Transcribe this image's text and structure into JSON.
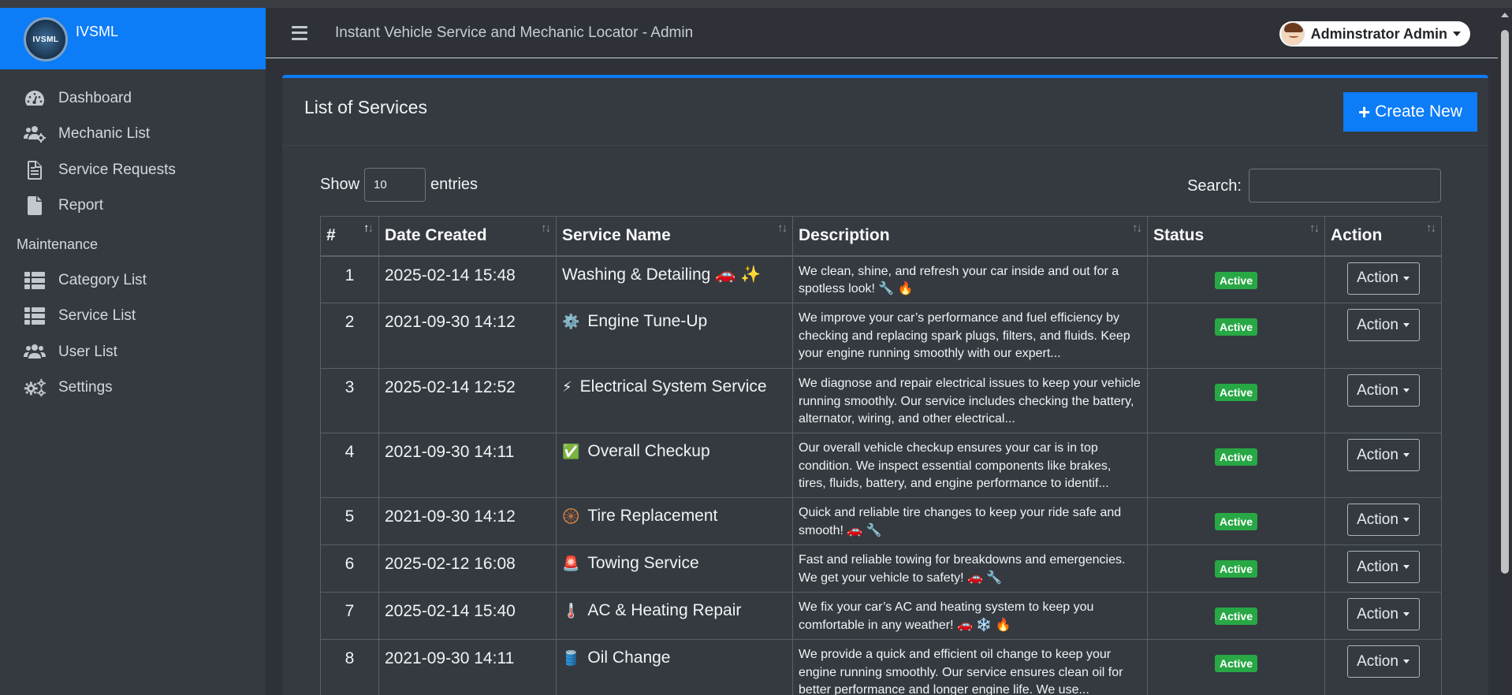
{
  "app": {
    "brand_short": "IVSML",
    "logo_text": "IVSML",
    "title": "Instant Vehicle Service and Mechanic Locator - Admin"
  },
  "user": {
    "name": "Adminstrator Admin"
  },
  "sidebar": {
    "items": [
      {
        "label": "Dashboard",
        "icon": "tachometer-icon"
      },
      {
        "label": "Mechanic List",
        "icon": "users-cog-icon"
      },
      {
        "label": "Service Requests",
        "icon": "file-alt-icon"
      },
      {
        "label": "Report",
        "icon": "file-icon"
      }
    ],
    "section_header": "Maintenance",
    "maintenance_items": [
      {
        "label": "Category List",
        "icon": "th-list-icon"
      },
      {
        "label": "Service List",
        "icon": "th-list-icon"
      },
      {
        "label": "User List",
        "icon": "users-icon"
      },
      {
        "label": "Settings",
        "icon": "cogs-icon"
      }
    ]
  },
  "card": {
    "title": "List of Services",
    "create_label": "Create New"
  },
  "controls": {
    "show_label": "Show",
    "entries_value": "10",
    "entries_label": "entries",
    "search_label": "Search:",
    "search_value": ""
  },
  "table": {
    "columns": [
      "#",
      "Date Created",
      "Service Name",
      "Description",
      "Status",
      "Action"
    ],
    "rows": [
      {
        "num": "1",
        "date": "2025-02-14 15:48",
        "emoji": "",
        "name": "Washing & Detailing 🚗 ✨",
        "desc": "We clean, shine, and refresh your car inside and out for a spotless look! 🔧 🔥",
        "status": "Active",
        "action": "Action"
      },
      {
        "num": "2",
        "date": "2021-09-30 14:12",
        "emoji": "⚙️",
        "name": "Engine Tune-Up",
        "desc": "We improve your car’s performance and fuel efficiency by checking and replacing spark plugs, filters, and fluids. Keep your engine running smoothly with our expert...",
        "status": "Active",
        "action": "Action"
      },
      {
        "num": "3",
        "date": "2025-02-14 12:52",
        "emoji": "⚡",
        "name": "Electrical System Service",
        "desc": "We diagnose and repair electrical issues to keep your vehicle running smoothly. Our service includes checking the battery, alternator, wiring, and other electrical...",
        "status": "Active",
        "action": "Action"
      },
      {
        "num": "4",
        "date": "2021-09-30 14:11",
        "emoji": "✅",
        "name": "Overall Checkup",
        "desc": "Our overall vehicle checkup ensures your car is in top condition. We inspect essential components like brakes, tires, fluids, battery, and engine performance to identif...",
        "status": "Active",
        "action": "Action"
      },
      {
        "num": "5",
        "date": "2021-09-30 14:12",
        "emoji": "🛞",
        "name": "Tire Replacement",
        "desc": " Quick and reliable tire changes to keep your ride safe and smooth! 🚗 🔧",
        "status": "Active",
        "action": "Action"
      },
      {
        "num": "6",
        "date": "2025-02-12 16:08",
        "emoji": "🚨",
        "name": "Towing Service",
        "desc": "Fast and reliable towing for breakdowns and emergencies. We get your vehicle to safety! 🚗 🔧",
        "status": "Active",
        "action": "Action"
      },
      {
        "num": "7",
        "date": "2025-02-14 15:40",
        "emoji": "🌡️",
        "name": "AC & Heating Repair",
        "desc": "We fix your car’s AC and heating system to keep you comfortable in any weather! 🚗 ❄️ 🔥",
        "status": "Active",
        "action": "Action"
      },
      {
        "num": "8",
        "date": "2021-09-30 14:11",
        "emoji": "🛢️",
        "name": "Oil Change",
        "desc": "We provide a quick and efficient oil change to keep your engine running smoothly. Our service ensures clean oil for better performance and longer engine life. We use...",
        "status": "Active",
        "action": "Action"
      }
    ]
  },
  "colors": {
    "primary": "#0d7cf7",
    "sidebar_bg": "#343a40",
    "body_bg": "#2e3238",
    "active_badge": "#28a745"
  }
}
